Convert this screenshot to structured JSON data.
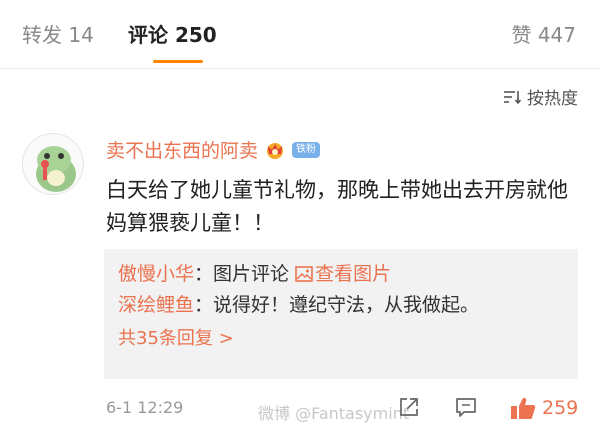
{
  "tabs": {
    "repost": "转发 14",
    "comments": "评论 250",
    "likes": "赞 447"
  },
  "sort": {
    "label": "按热度"
  },
  "comment": {
    "username": "卖不出东西的阿卖",
    "badge": "铁粉",
    "text": "白天给了她儿童节礼物，那晚上带她出去开房就他妈算猥亵儿童！！",
    "time": "6-1 12:29",
    "like_count": "259"
  },
  "replies": [
    {
      "user": "傲慢小华",
      "sep": "：",
      "text": "图片评论 ",
      "link": "查看图片"
    },
    {
      "user": "深绘鲤鱼",
      "sep": "：",
      "text": "说得好！遵纪守法，从我做起。"
    }
  ],
  "more_replies": "共35条回复 >",
  "watermark": "微博 @Fantasymint",
  "colors": {
    "accent": "#ff8200",
    "username": "#eb7350",
    "reply_bg": "#f2f2f2"
  }
}
